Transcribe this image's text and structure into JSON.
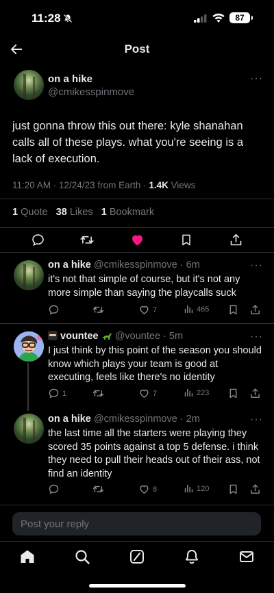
{
  "status_bar": {
    "time": "11:28",
    "battery": "87"
  },
  "nav": {
    "title": "Post"
  },
  "main_post": {
    "name": "on a hike",
    "handle": "@cmikesspinmove",
    "text": "just gonna throw this out there: kyle shanahan calls all of these plays. what you're seeing is a lack of execution.",
    "meta_time": "11:20 AM · 12/24/23 from Earth · ",
    "views_count": "1.4K",
    "views_label": " Views",
    "quotes": "1",
    "quotes_label": "Quote",
    "likes": "38",
    "likes_label": "Likes",
    "bookmarks": "1",
    "bookmarks_label": "Bookmark",
    "liked_color": "#f91880"
  },
  "replies": [
    {
      "name": "on a hike",
      "handle": "@cmikesspinmove · 6m",
      "text": "it's not that simple of course, but it's not any more simple than saying the playcalls suck",
      "comments": "",
      "retweets": "",
      "likes": "7",
      "views": "465"
    },
    {
      "name_prefix_icon": "ninja-emoji",
      "name": "vountee",
      "name_suffix_icon": "dinosaur-emoji",
      "handle": "@vountee · 5m",
      "text": "I just think by this point of the season you should know which plays your team is good at executing, feels like there's no identity",
      "comments": "1",
      "retweets": "",
      "likes": "7",
      "views": "223"
    },
    {
      "name": "on a hike",
      "handle": "@cmikesspinmove · 2m",
      "text": "the last time all the starters were playing they scored 35 points against a top 5 defense. i think they need to pull their heads out of their ass, not find an identity",
      "comments": "",
      "retweets": "",
      "likes": "8",
      "views": "120"
    }
  ],
  "reply_box": {
    "placeholder": "Post your reply"
  },
  "tabbar": [
    "home-icon",
    "search-icon",
    "grok-icon",
    "notifications-icon",
    "messages-icon"
  ]
}
